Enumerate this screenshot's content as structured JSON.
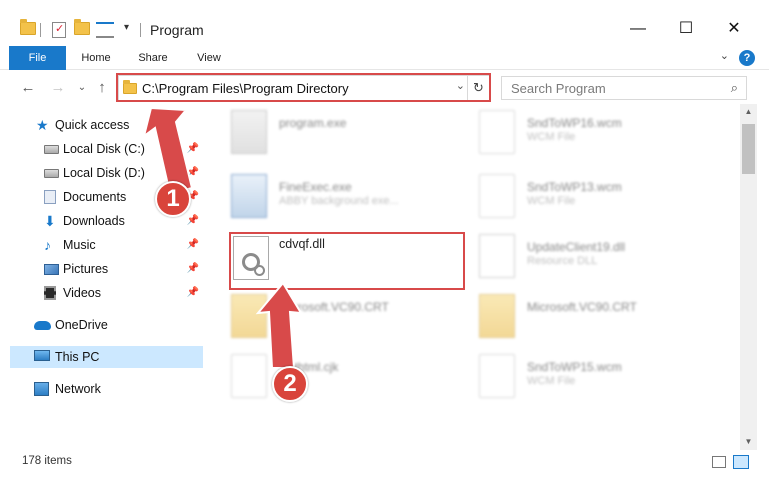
{
  "window": {
    "title": "Program",
    "minimize": "—",
    "maximize": "☐",
    "close": "✕"
  },
  "ribbon": {
    "tabs": [
      "File",
      "Home",
      "Share",
      "View"
    ],
    "help": "?",
    "collapse": "⌄"
  },
  "navigation": {
    "back": "←",
    "forward": "→",
    "recent": "⌄",
    "up": "↑",
    "address": "C:\\Program Files\\Program Directory",
    "address_dropdown": "⌄",
    "refresh": "↻",
    "search_placeholder": "Search Program",
    "search_icon": "search-icon"
  },
  "nav_pane": {
    "items": [
      {
        "label": "Quick access",
        "icon": "star-icon",
        "pinned": false
      },
      {
        "label": "Local Disk (C:)",
        "icon": "drive-icon",
        "pinned": true
      },
      {
        "label": "Local Disk (D:)",
        "icon": "drive-icon",
        "pinned": true
      },
      {
        "label": "Documents",
        "icon": "documents-icon",
        "pinned": true
      },
      {
        "label": "Downloads",
        "icon": "downloads-icon",
        "pinned": true
      },
      {
        "label": "Music",
        "icon": "music-icon",
        "pinned": true
      },
      {
        "label": "Pictures",
        "icon": "pictures-icon",
        "pinned": true
      },
      {
        "label": "Videos",
        "icon": "videos-icon",
        "pinned": true
      },
      {
        "label": "OneDrive",
        "icon": "onedrive-icon",
        "pinned": false
      },
      {
        "label": "This PC",
        "icon": "this-pc-icon",
        "pinned": false,
        "selected": true
      },
      {
        "label": "Network",
        "icon": "network-icon",
        "pinned": false
      }
    ],
    "pin_glyph": "📌"
  },
  "files": [
    {
      "name": "program.exe",
      "type": "",
      "icon": "installer-icon"
    },
    {
      "name": "SndToWP16.wcm",
      "type": "WCM File",
      "icon": "file-icon"
    },
    {
      "name": "FineExec.exe",
      "type": "ABBY background exe...",
      "icon": "exe-icon"
    },
    {
      "name": "SndToWP13.wcm",
      "type": "WCM File",
      "icon": "file-icon"
    },
    {
      "name": "cdvqf.dll",
      "type": "",
      "icon": "dll-gear-icon"
    },
    {
      "name": "UpdateClient19.dll",
      "type": "Resource DLL",
      "icon": "dll-icon"
    },
    {
      "name": "Microsoft.VC90.CRT",
      "type": "",
      "icon": "folder-file-icon"
    },
    {
      "name": "Microsoft.VC90.CRT",
      "type": "",
      "icon": "folder-file-icon"
    },
    {
      "name": "Listhtml.cjk",
      "type": "",
      "icon": "file-icon"
    },
    {
      "name": "SndToWP15.wcm",
      "type": "WCM File",
      "icon": "file-icon"
    }
  ],
  "annotations": {
    "step1": "1",
    "step2": "2",
    "accent": "#d84a4a"
  },
  "status": {
    "item_count": "178 items"
  },
  "colors": {
    "accent": "#1979ca",
    "selection": "#cce8ff"
  }
}
